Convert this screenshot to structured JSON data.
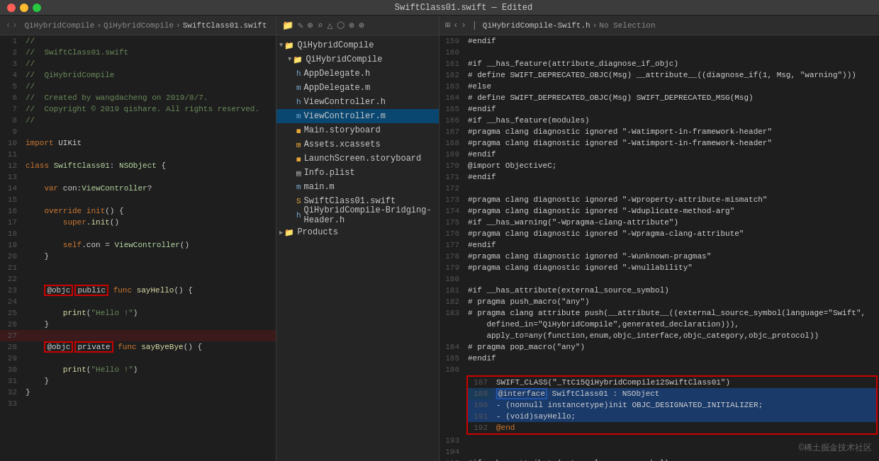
{
  "titlebar": {
    "title": "SwiftClass01.swift — Edited"
  },
  "code_panel": {
    "breadcrumbs": [
      "QiHybridCompile",
      "QiHybridCompile",
      "SwiftClass01.swift"
    ]
  },
  "tree_panel": {
    "root": "QiHybridCompile",
    "items": [
      {
        "id": "root-group",
        "label": "QiHybridCompile",
        "indent": 0,
        "type": "group",
        "expanded": true
      },
      {
        "id": "appdelegate-h",
        "label": "AppDelegate.h",
        "indent": 1,
        "type": "h-file"
      },
      {
        "id": "appdelegate-m",
        "label": "AppDelegate.m",
        "indent": 1,
        "type": "m-file"
      },
      {
        "id": "viewcontroller-h",
        "label": "ViewController.h",
        "indent": 1,
        "type": "h-file"
      },
      {
        "id": "viewcontroller-m",
        "label": "ViewController.m",
        "indent": 1,
        "type": "m-file",
        "selected": true
      },
      {
        "id": "main-storyboard",
        "label": "Main.storyboard",
        "indent": 1,
        "type": "storyboard"
      },
      {
        "id": "assets",
        "label": "Assets.xcassets",
        "indent": 1,
        "type": "assets"
      },
      {
        "id": "launchscreen",
        "label": "LaunchScreen.storyboard",
        "indent": 1,
        "type": "storyboard"
      },
      {
        "id": "info-plist",
        "label": "Info.plist",
        "indent": 1,
        "type": "plist"
      },
      {
        "id": "main-m",
        "label": "main.m",
        "indent": 1,
        "type": "m-file"
      },
      {
        "id": "swiftclass",
        "label": "SwiftClass01.swift",
        "indent": 1,
        "type": "swift"
      },
      {
        "id": "bridging",
        "label": "QiHybridCompile-Bridging-Header.h",
        "indent": 1,
        "type": "h-file"
      },
      {
        "id": "products",
        "label": "Products",
        "indent": 0,
        "type": "group",
        "expanded": false
      }
    ]
  },
  "header_panel": {
    "breadcrumbs": [
      "QiHybridCompile-Swift.h",
      "No Selection"
    ]
  },
  "watermark": "©稀土掘金技术社区"
}
